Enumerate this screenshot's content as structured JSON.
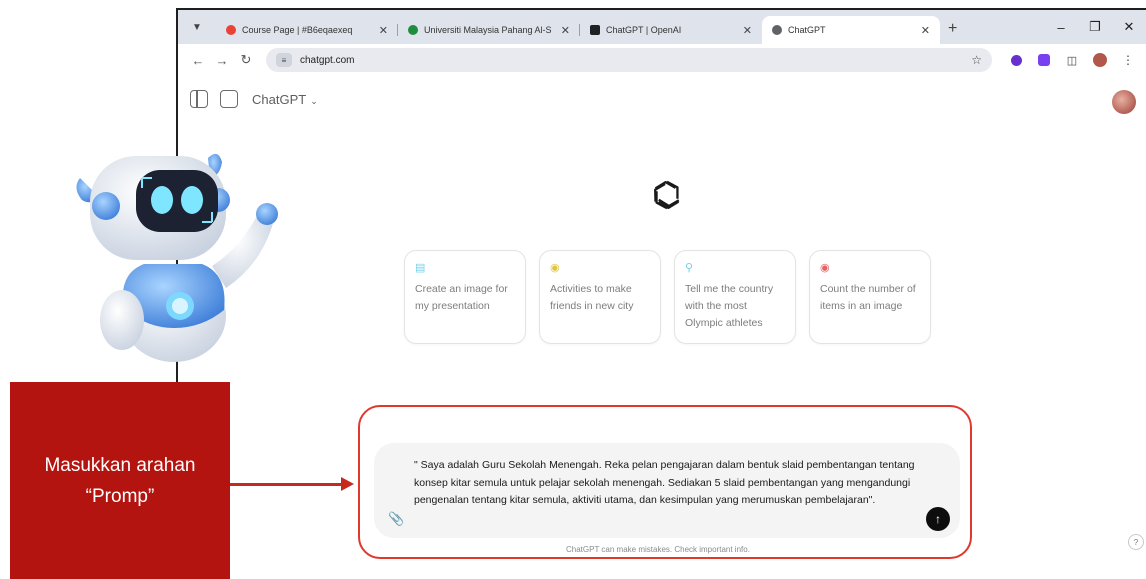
{
  "browser": {
    "tabs": [
      {
        "title": "Course Page | #B6eqaexeq",
        "favicon_color": "#ea4335",
        "active": false
      },
      {
        "title": "Universiti Malaysia Pahang Al-S",
        "favicon_color": "#1e8e3e",
        "active": false
      },
      {
        "title": "ChatGPT | OpenAI",
        "favicon_color": "#202124",
        "active": false
      },
      {
        "title": "ChatGPT",
        "favicon_color": "#5f6368",
        "active": true
      }
    ],
    "url": "chatgpt.com"
  },
  "chatgpt": {
    "model_label": "ChatGPT",
    "suggestions": [
      {
        "icon": "image-icon",
        "icon_color": "#76d0eb",
        "text": "Create an image for my presentation"
      },
      {
        "icon": "lightbulb-icon",
        "icon_color": "#e2c541",
        "text": "Activities to make friends in new city"
      },
      {
        "icon": "search-icon",
        "icon_color": "#76d0eb",
        "text": "Tell me the country with the most Olympic athletes"
      },
      {
        "icon": "eye-icon",
        "icon_color": "#e86161",
        "text": "Count the number of items in an image"
      }
    ],
    "prompt_text": "\" Saya adalah Guru Sekolah Menengah. Reka pelan pengajaran dalam bentuk slaid pembentangan tentang konsep kitar semula untuk pelajar sekolah menengah. Sediakan 5 slaid pembentangan yang mengandungi pengenalan tentang kitar semula, aktiviti utama, dan kesimpulan yang merumuskan pembelajaran\".",
    "disclaimer": "ChatGPT can make mistakes. Check important info."
  },
  "annotation": {
    "label_line1": "Masukkan arahan",
    "label_line2": "“Promp”",
    "accent_color": "#b3140f"
  }
}
